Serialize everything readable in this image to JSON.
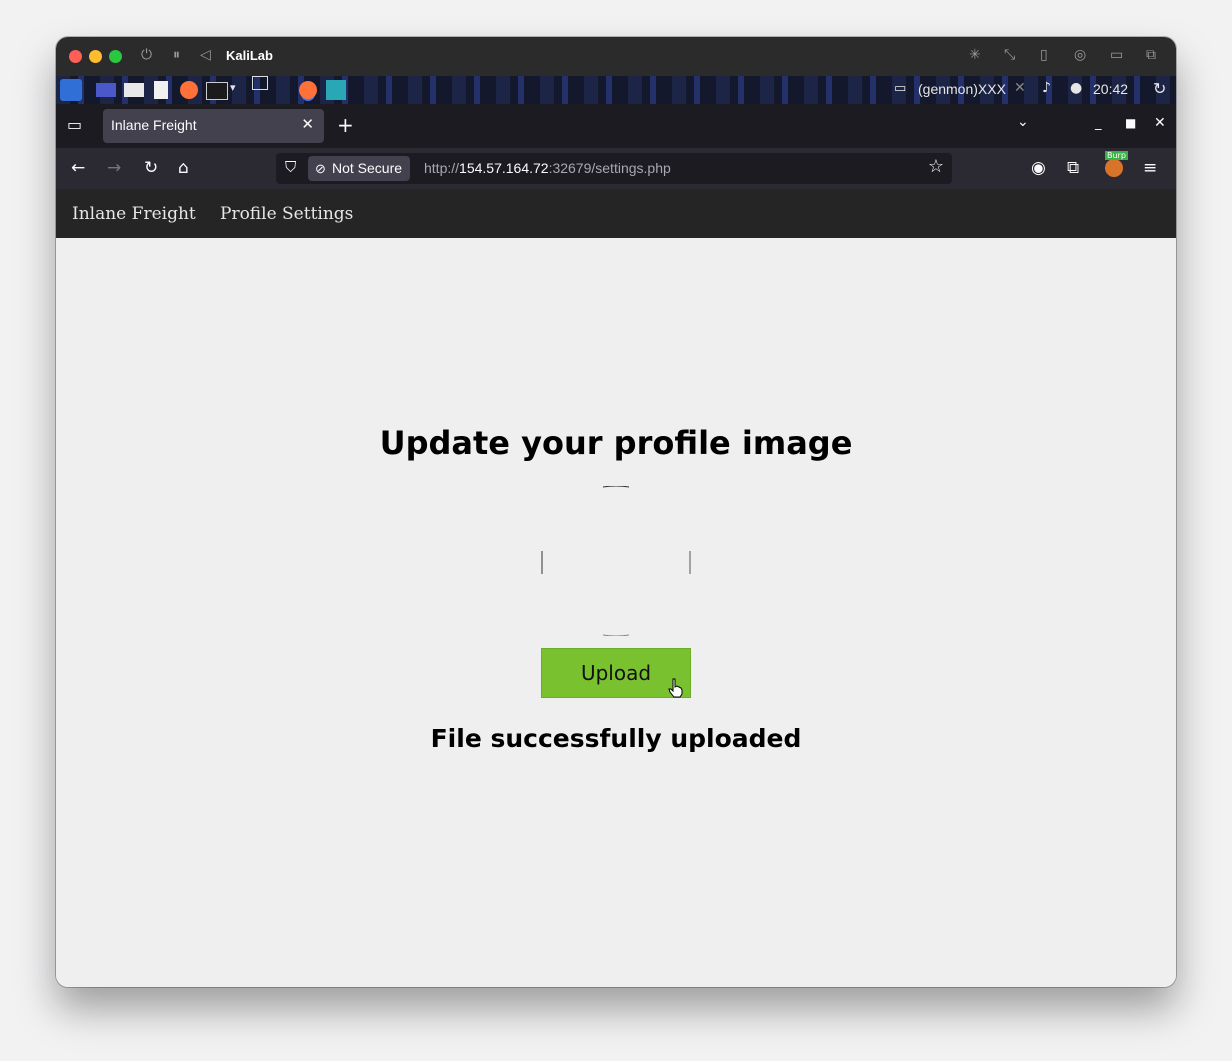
{
  "vm": {
    "title": "KaliLab",
    "colors": {
      "close": "#ff5f57",
      "minimize": "#febc2e",
      "zoom": "#28c840"
    }
  },
  "panel": {
    "genmon": "(genmon)XXX",
    "clock": "20:42"
  },
  "browser": {
    "tab_title": "Inlane Freight",
    "not_secure_label": "Not Secure",
    "url_scheme": "http://",
    "url_host": "154.57.164.72",
    "url_rest": ":32679/settings.php",
    "burp_badge": "Burp"
  },
  "site": {
    "brand": "Inlane Freight",
    "nav_profile": "Profile Settings",
    "heading": "Update your profile image",
    "upload_label": "Upload",
    "status_message": "File successfully uploaded",
    "colors": {
      "button": "#7ac12f",
      "navbar": "#252525"
    }
  }
}
